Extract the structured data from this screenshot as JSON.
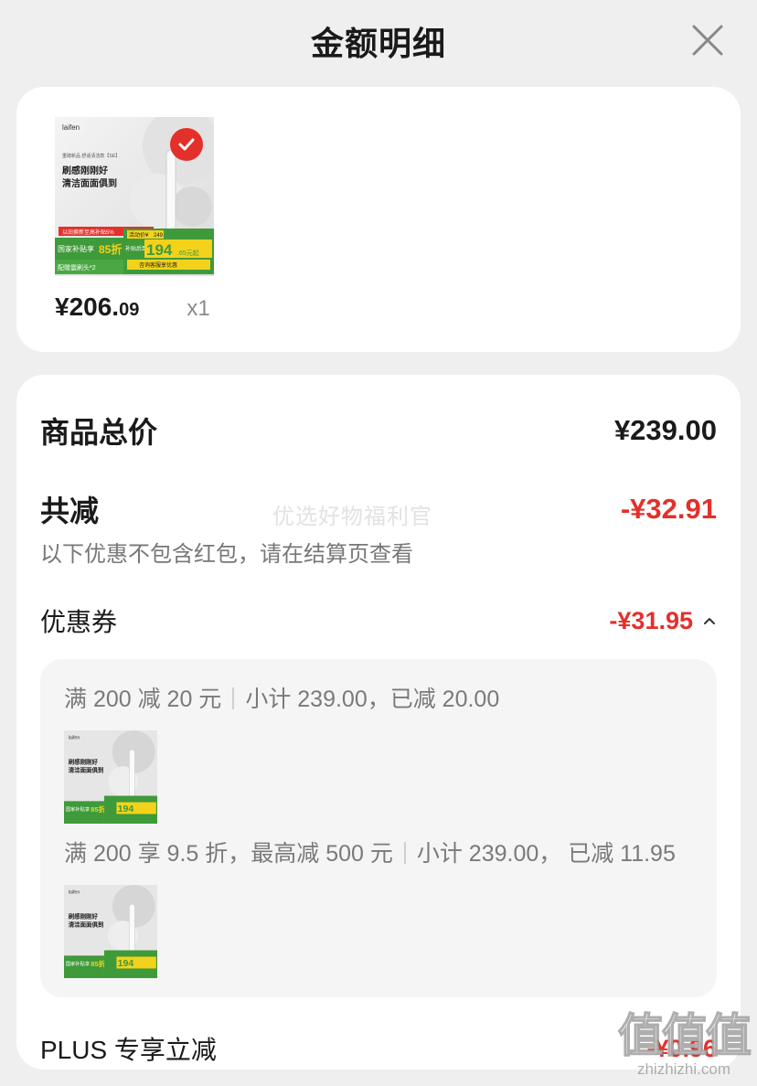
{
  "header": {
    "title": "金额明细"
  },
  "product": {
    "price_main": "¥206.",
    "price_decimal": "09",
    "qty": "x1",
    "thumb": {
      "brand": "laifen",
      "subtitle": "重磅新品 舒适清洁款【SE】",
      "headline_1": "刷感刚刚好",
      "headline_2": "清洁面面俱到",
      "tag_trade_in": "以旧换新至高补贴5%",
      "tag_subsidy": "国家补贴享",
      "tag_subsidy_num": "85折",
      "tag_brush": "配赠震刷头*2",
      "promo_label": "活动价¥",
      "promo_old": "249",
      "promo_after": "补贴后到手价",
      "promo_price": "194",
      "promo_price_suffix": ".65元起",
      "promo_consult": "咨询客服享优惠"
    }
  },
  "summary": {
    "total_label": "商品总价",
    "total_value": "¥239.00",
    "reduce_label": "共减",
    "reduce_value": "-¥32.91",
    "note": "以下优惠不包含红包，请在结算页查看",
    "coupon_label": "优惠券",
    "coupon_value": "-¥31.95",
    "coupon_lines": [
      {
        "rule": "满 200 减 20 元",
        "detail": "小计 239.00，已减 20.00"
      },
      {
        "rule": "满 200 享 9.5 折，最高减 500 元",
        "detail": "小计 239.00， 已减 11.95"
      }
    ],
    "plus_label": "PLUS 专享立减",
    "plus_value": "-¥0.96"
  },
  "overlay": {
    "watermark": "优选好物福利官",
    "brand_big": "值值值",
    "brand_small": "zhizhizhi.com"
  },
  "colors": {
    "accent_red": "#e4302b",
    "thumb_green": "#3f9a3a",
    "thumb_yellow": "#f4d21c"
  }
}
